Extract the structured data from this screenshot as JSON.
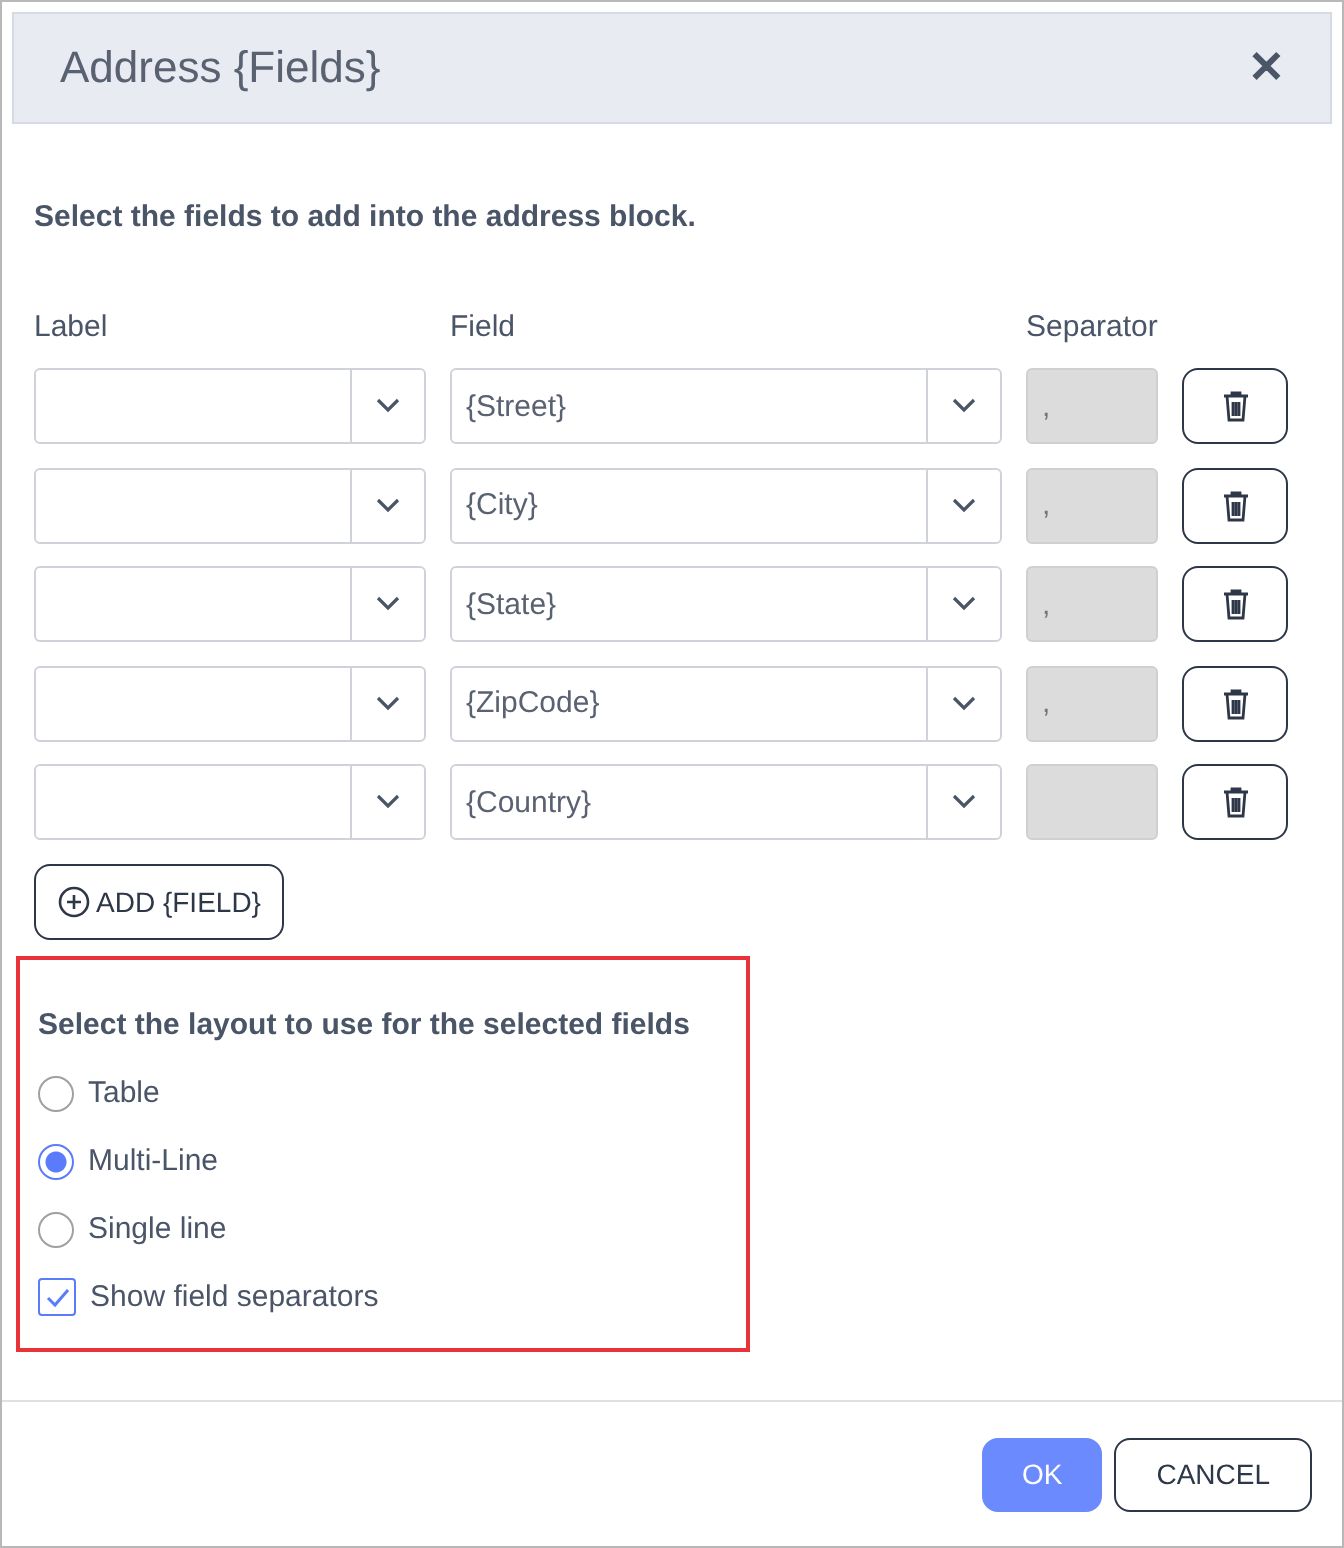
{
  "window": {
    "title": "Address {Fields}",
    "close": "✕"
  },
  "instruction": "Select the fields to add into the address block.",
  "columns": [
    "Label",
    "Field",
    "Separator"
  ],
  "rows": [
    {
      "field": "{Street}",
      "separator": ","
    },
    {
      "field": "{City}",
      "separator": ","
    },
    {
      "field": "{State}",
      "separator": ","
    },
    {
      "field": "{ZipCode}",
      "separator": ","
    },
    {
      "field": "{Country}"
    }
  ],
  "add_button": "ADD {FIELD}",
  "layout": {
    "title": "Select the layout to use for the selected fields",
    "options": [
      {
        "label": "Table",
        "selected": false
      },
      {
        "label": "Multi-Line",
        "selected": true
      },
      {
        "label": "Single line",
        "selected": false
      }
    ],
    "separators": {
      "label": "Show field separators",
      "checked": true
    }
  },
  "buttons": [
    {
      "label": "OK",
      "kind": "primary"
    },
    {
      "label": "CANCEL",
      "kind": "secondary"
    }
  ]
}
